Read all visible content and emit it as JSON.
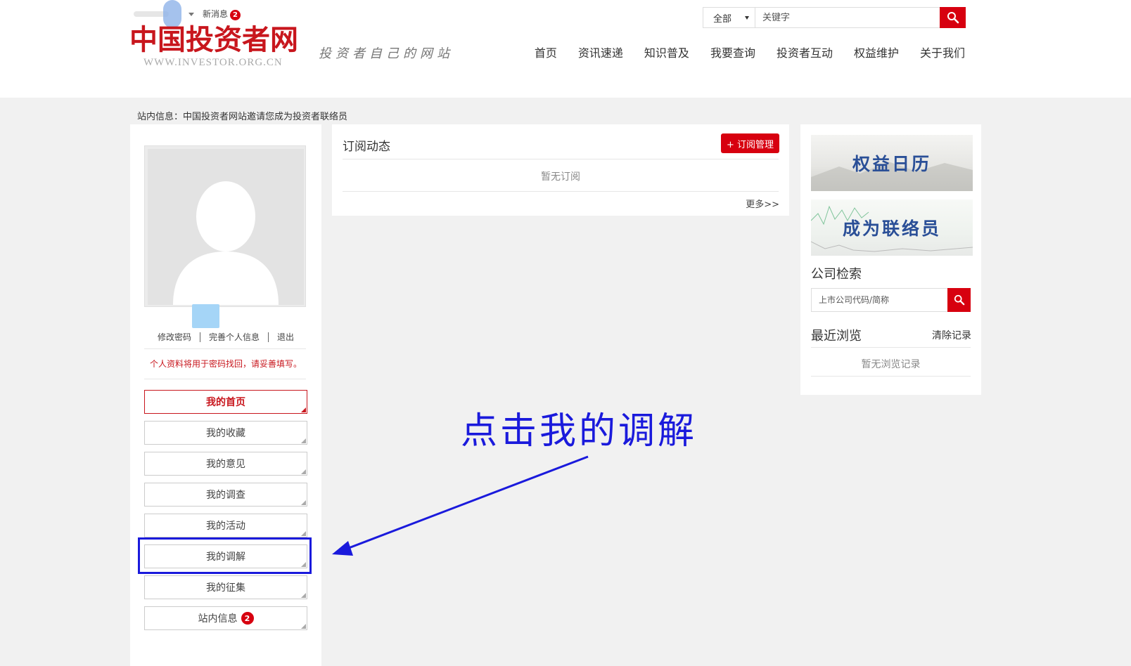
{
  "header": {
    "new_msg_label": "新消息",
    "new_msg_count": "2",
    "logo_title": "中国投资者网",
    "logo_domain": "WWW.INVESTOR.ORG.CN",
    "slogan": "投资者自己的网站",
    "search": {
      "scope": "全部",
      "placeholder": "关键字"
    },
    "nav": [
      "首页",
      "资讯速递",
      "知识普及",
      "我要查询",
      "投资者互动",
      "权益维护",
      "关于我们"
    ]
  },
  "notice": "站内信息：中国投资者网站邀请您成为投资者联络员",
  "left": {
    "links": {
      "change_password": "修改密码",
      "complete_info": "完善个人信息",
      "logout": "退出"
    },
    "tip": "个人资料将用于密码找回，请妥善填写。",
    "menu": [
      "我的首页",
      "我的收藏",
      "我的意见",
      "我的调查",
      "我的活动",
      "我的调解",
      "我的征集",
      "站内信息"
    ],
    "message_badge": "2"
  },
  "middle": {
    "title": "订阅动态",
    "manage_button": "+ 订阅管理",
    "empty_text": "暂无订阅",
    "more": "更多>>"
  },
  "right": {
    "banner1": "权益日历",
    "banner2": "成为联络员",
    "company_search_title": "公司检索",
    "company_search_placeholder": "上市公司代码/简称",
    "recent_title": "最近浏览",
    "clear_label": "清除记录",
    "recent_empty": "暂无浏览记录"
  },
  "annotation": {
    "text": "点击我的调解",
    "color": "#1a1adc"
  },
  "colors": {
    "brand_red": "#d7000f",
    "logo_red": "#c8161d",
    "banner_blue": "#2a4f97"
  }
}
